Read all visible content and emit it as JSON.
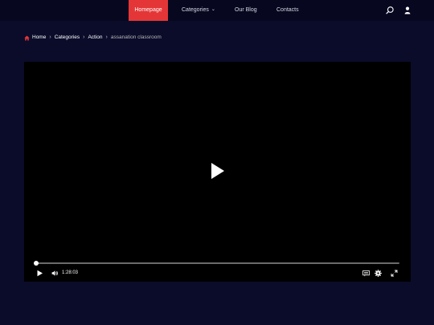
{
  "nav": {
    "items": [
      {
        "label": "Homepage",
        "active": true
      },
      {
        "label": "Categories",
        "dropdown": true
      },
      {
        "label": "Our Blog"
      },
      {
        "label": "Contacts"
      }
    ],
    "icons": [
      "search-icon",
      "user-icon"
    ],
    "accent_color": "#e53637"
  },
  "breadcrumb": {
    "items": [
      "Home",
      "Categories",
      "Action"
    ],
    "current": "assanation classroom"
  },
  "player": {
    "time": "1:28:03",
    "progress": 0.0,
    "icons": [
      "big-play-icon",
      "play-icon",
      "volume-icon",
      "captions-icon",
      "settings-icon",
      "fullscreen-icon"
    ]
  }
}
